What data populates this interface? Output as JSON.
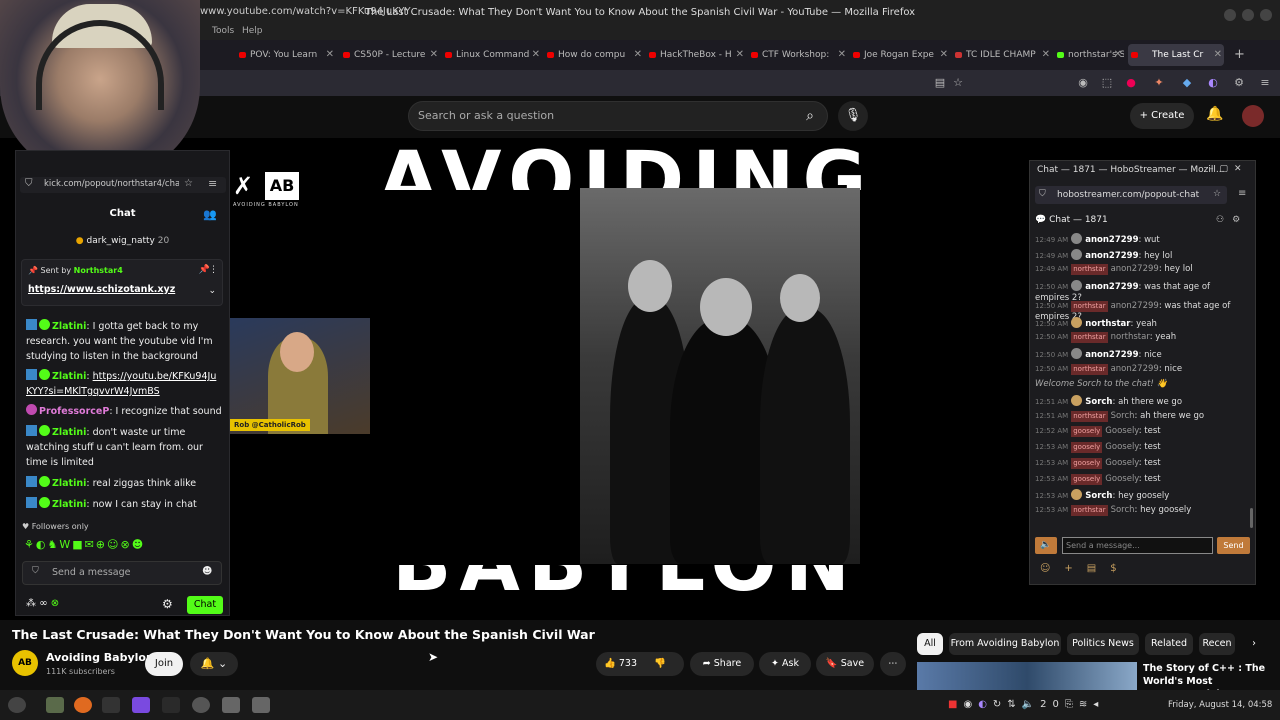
{
  "window": {
    "title": "The Last Crusade: What They Don't Want You to Know About the Spanish Civil War - YouTube — Mozilla Firefox"
  },
  "menu": [
    "Tools",
    "Help"
  ],
  "tabs": [
    {
      "label": "POV: You Learn"
    },
    {
      "label": "CS50P - Lecture"
    },
    {
      "label": "Linux Command"
    },
    {
      "label": "How do compu"
    },
    {
      "label": "HackTheBox - H"
    },
    {
      "label": "CTF Workshop:"
    },
    {
      "label": "Joe Rogan Expe"
    },
    {
      "label": "TC IDLE CHAMP"
    },
    {
      "label": "northstar's Stre"
    },
    {
      "label": "The Last Cr"
    }
  ],
  "url": "www.youtube.com/watch?v=KFKu94JuKYY",
  "youtube": {
    "search_placeholder": "Search or ask a question",
    "create_label": "Create"
  },
  "video_overlay": {
    "top_text": "AVOIDING",
    "bottom_text": "BABYLON",
    "logo_letters": "AB",
    "logo_sub": "AVOIDING BABYLON",
    "cam_label": "Rob @CatholicRob"
  },
  "kick": {
    "url": "kick.com/popout/northstar4/chat",
    "title": "Chat",
    "top_user": "dark_wig_natty",
    "top_user_count": "20",
    "pinned_sent_by": "Sent by",
    "pinned_author": "Northstar4",
    "pinned_link": "https://www.schizotank.xyz",
    "messages": [
      {
        "user": "Zlatini",
        "text": "I gotta get back to my research. you want the youtube vid I'm studying to listen in the background"
      },
      {
        "user": "Zlatini",
        "text": "https://youtu.be/KFKu94JuKYY?si=MKlTgqvvrW4JvmBS"
      },
      {
        "user": "ProfessorceP",
        "text": "I recognize that sound"
      },
      {
        "user": "Zlatini",
        "text": "don't waste ur time watching stuff u can't learn from. our time is limited"
      },
      {
        "user": "Zlatini",
        "text": "real ziggas think alike"
      },
      {
        "user": "Zlatini",
        "text": "now I can stay in chat"
      }
    ],
    "followers_only": "Followers only",
    "input_placeholder": "Send a message",
    "chat_button": "Chat"
  },
  "hobo": {
    "window_title": "Chat — 1871 — HoboStreamer — Mozill...",
    "url": "hobostreamer.com/popout-chat",
    "chat_header": "Chat — 1871",
    "messages": [
      {
        "time": "12:49 AM",
        "kind": "user",
        "user": "anon27299",
        "text": "wut"
      },
      {
        "time": "12:49 AM",
        "kind": "user",
        "user": "anon27299",
        "text": "hey lol"
      },
      {
        "time": "12:49 AM",
        "kind": "relay",
        "tag": "northstar",
        "user": "anon27299",
        "text": "hey lol"
      },
      {
        "time": "12:50 AM",
        "kind": "user",
        "user": "anon27299",
        "text": "was that age of empires 2?"
      },
      {
        "time": "12:50 AM",
        "kind": "relay",
        "tag": "northstar",
        "user": "anon27299",
        "text": "was that age of empires 2?"
      },
      {
        "time": "12:50 AM",
        "kind": "user",
        "user": "northstar",
        "text": "yeah"
      },
      {
        "time": "12:50 AM",
        "kind": "relay",
        "tag": "northstar",
        "user": "northstar",
        "text": "yeah"
      },
      {
        "time": "12:50 AM",
        "kind": "user",
        "user": "anon27299",
        "text": "nice"
      },
      {
        "time": "12:50 AM",
        "kind": "relay",
        "tag": "northstar",
        "user": "anon27299",
        "text": "nice"
      },
      {
        "time": "",
        "kind": "system",
        "user": "",
        "text": "Welcome Sorch to the chat! 👋"
      },
      {
        "time": "12:51 AM",
        "kind": "user",
        "user": "Sorch",
        "text": "ah there we go"
      },
      {
        "time": "12:51 AM",
        "kind": "relay",
        "tag": "northstar",
        "user": "Sorch",
        "text": "ah there we go"
      },
      {
        "time": "12:52 AM",
        "kind": "relay",
        "tag": "goosely",
        "user": "Goosely",
        "text": "test"
      },
      {
        "time": "12:53 AM",
        "kind": "relay",
        "tag": "goosely",
        "user": "Goosely",
        "text": "test"
      },
      {
        "time": "12:53 AM",
        "kind": "relay",
        "tag": "goosely",
        "user": "Goosely",
        "text": "test"
      },
      {
        "time": "12:53 AM",
        "kind": "relay",
        "tag": "goosely",
        "user": "Goosely",
        "text": "test"
      },
      {
        "time": "12:53 AM",
        "kind": "user",
        "user": "Sorch",
        "text": "hey goosely"
      },
      {
        "time": "12:53 AM",
        "kind": "relay",
        "tag": "northstar",
        "user": "Sorch",
        "text": "hey goosely"
      }
    ],
    "input_placeholder": "Send a message...",
    "send_label": "Send"
  },
  "video": {
    "title": "The Last Crusade: What They Don't Want You to Know About the Spanish Civil War",
    "channel": "Avoiding Babylon",
    "subscribers": "111K subscribers",
    "join_label": "Join",
    "likes": "733",
    "share_label": "Share",
    "ask_label": "Ask",
    "save_label": "Save"
  },
  "chips": [
    "All",
    "From Avoiding Babylon",
    "Politics News",
    "Related",
    "Recen"
  ],
  "recommendation": {
    "title": "The Story of C++ : The World's Most Consequential Programming Language"
  },
  "taskbar": {
    "clock": "Friday, August 14, 04:58",
    "volume_level": "20"
  },
  "colors": {
    "kick_green": "#53fc18",
    "hobo_orange": "#c07a3a",
    "yt_bg": "#0f0f0f"
  }
}
